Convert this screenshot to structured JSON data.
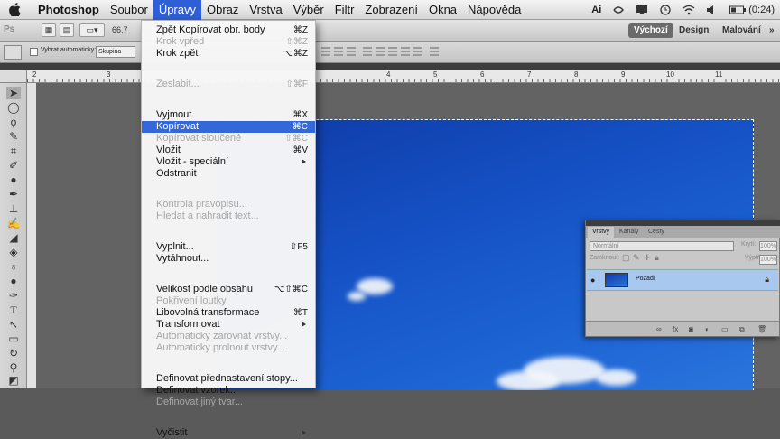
{
  "menubar": {
    "items": [
      "Photoshop",
      "Soubor",
      "Úpravy",
      "Obraz",
      "Vrstva",
      "Výběr",
      "Filtr",
      "Zobrazení",
      "Okna",
      "Nápověda"
    ],
    "active_index": 2,
    "right": {
      "battery": "(0:24)",
      "ps_icon": "Ai"
    }
  },
  "appbar": {
    "zoom": "66,7",
    "workspaces": [
      "Výchozí",
      "Design",
      "Malování"
    ],
    "more": "»"
  },
  "optbar": {
    "auto_select_label": "Vybrat automaticky:",
    "auto_select_value": "Skupina"
  },
  "ruler": {
    "numbers": [
      "2",
      "3",
      "4",
      "5",
      "6",
      "7",
      "8",
      "9",
      "10",
      "11"
    ]
  },
  "menu": {
    "groups": [
      [
        {
          "label": "Zpět Kopírovat obr. body",
          "shortcut": "⌘Z",
          "disabled": false
        },
        {
          "label": "Krok vpřed",
          "shortcut": "⇧⌘Z",
          "disabled": true
        },
        {
          "label": "Krok zpět",
          "shortcut": "⌥⌘Z",
          "disabled": false
        }
      ],
      [
        {
          "label": "Zeslabit...",
          "shortcut": "⇧⌘F",
          "disabled": true
        }
      ],
      [
        {
          "label": "Vyjmout",
          "shortcut": "⌘X",
          "disabled": false
        },
        {
          "label": "Kopírovat",
          "shortcut": "⌘C",
          "disabled": false,
          "highlighted": true
        },
        {
          "label": "Kopírovat sloučené",
          "shortcut": "⇧⌘C",
          "disabled": true
        },
        {
          "label": "Vložit",
          "shortcut": "⌘V",
          "disabled": false
        },
        {
          "label": "Vložit - speciální",
          "shortcut": "",
          "disabled": false,
          "submenu": true
        },
        {
          "label": "Odstranit",
          "shortcut": "",
          "disabled": false
        }
      ],
      [
        {
          "label": "Kontrola pravopisu...",
          "shortcut": "",
          "disabled": true
        },
        {
          "label": "Hledat a nahradit text...",
          "shortcut": "",
          "disabled": true
        }
      ],
      [
        {
          "label": "Vyplnit...",
          "shortcut": "⇧F5",
          "disabled": false
        },
        {
          "label": "Vytáhnout...",
          "shortcut": "",
          "disabled": false
        }
      ],
      [
        {
          "label": "Velikost podle obsahu",
          "shortcut": "⌥⇧⌘C",
          "disabled": false
        },
        {
          "label": "Pokřivení loutky",
          "shortcut": "",
          "disabled": true
        },
        {
          "label": "Libovolná transformace",
          "shortcut": "⌘T",
          "disabled": false
        },
        {
          "label": "Transformovat",
          "shortcut": "",
          "disabled": false,
          "submenu": true
        },
        {
          "label": "Automaticky zarovnat vrstvy...",
          "shortcut": "",
          "disabled": true
        },
        {
          "label": "Automaticky prolnout vrstvy...",
          "shortcut": "",
          "disabled": true
        }
      ],
      [
        {
          "label": "Definovat přednastavení stopy...",
          "shortcut": "",
          "disabled": false
        },
        {
          "label": "Definovat vzorek...",
          "shortcut": "",
          "disabled": false
        },
        {
          "label": "Definovat jiný tvar...",
          "shortcut": "",
          "disabled": true
        }
      ],
      [
        {
          "label": "Vyčistit",
          "shortcut": "",
          "disabled": false,
          "submenu": true
        }
      ]
    ]
  },
  "layers_panel": {
    "tabs": [
      "Vrstvy",
      "Kanály",
      "Cesty"
    ],
    "blend_mode": "Normální",
    "opacity_label": "Krytí:",
    "opacity_value": "100%",
    "lock_label": "Zamknout:",
    "fill_label": "Výplň:",
    "fill_value": "100%",
    "layer_name": "Pozadí"
  },
  "colors": {
    "menu_highlight": "#3468d8",
    "sky": "#1551c4",
    "layer_selected": "#a8c8f0"
  }
}
